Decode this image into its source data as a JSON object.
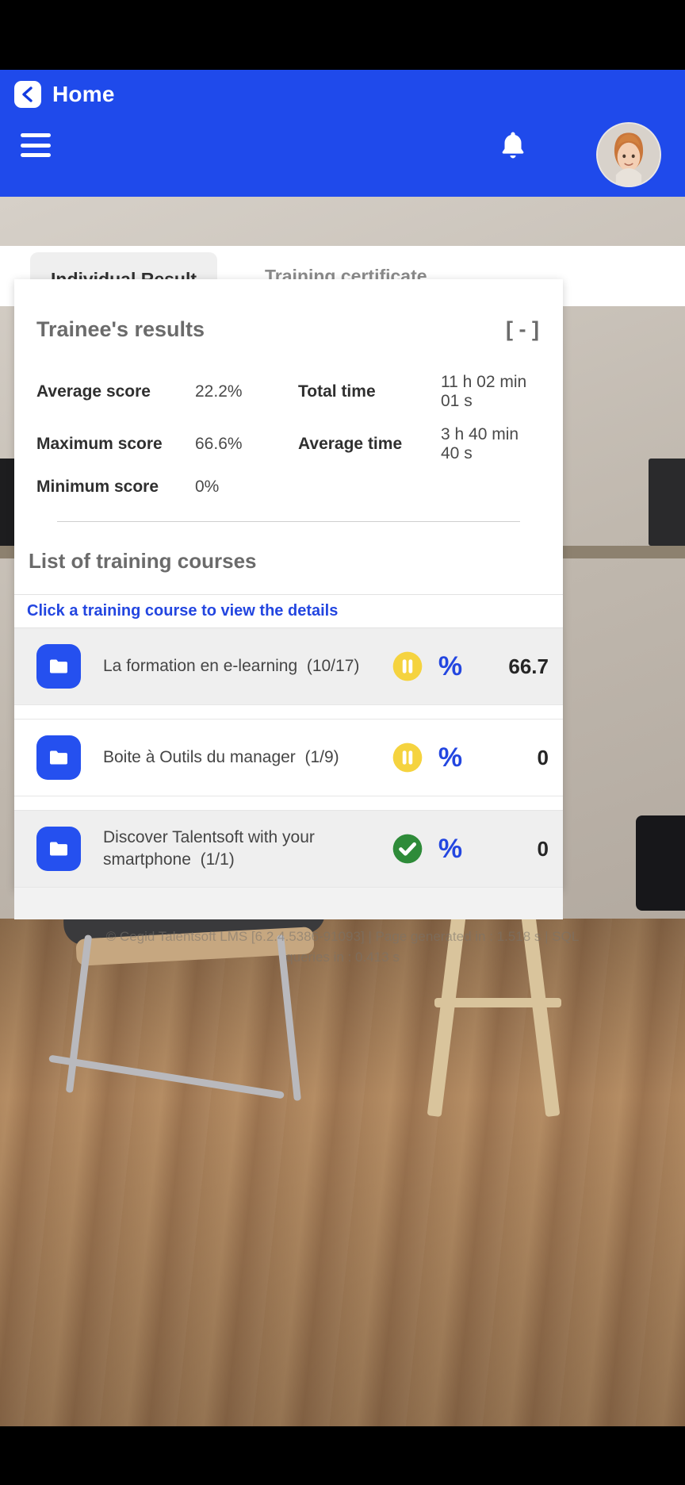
{
  "appbar": {
    "back_icon": "chevron-left-icon",
    "title": "Home",
    "menu_icon": "hamburger-icon",
    "bell_icon": "notification-bell-icon",
    "avatar_icon": "user-avatar",
    "background_color": "#1f4aeb"
  },
  "tabs": [
    {
      "label": "Individual Result",
      "active": true
    },
    {
      "label": "Training certificate",
      "active": false
    }
  ],
  "results_card": {
    "title": "Trainee's results",
    "collapse_label": "[ - ]",
    "stats": [
      {
        "label": "Average score",
        "value": "22.2%",
        "label2": "Total time",
        "value2": "11 h 02 min 01 s"
      },
      {
        "label": "Maximum score",
        "value": "66.6%",
        "label2": "Average time",
        "value2": "3 h 40 min 40 s"
      },
      {
        "label": "Minimum score",
        "value": "0%",
        "label2": "",
        "value2": ""
      }
    ],
    "section_title": "List of training courses",
    "hint": "Click a training course to view the details",
    "hint_color": "#2346e0",
    "courses": [
      {
        "icon": "folder-icon",
        "name": "La formation en e-learning",
        "progress": "(10/17)",
        "status_icon": "pause-circle-icon",
        "status_color": "#f5d33f",
        "percent_icon": "percent-icon",
        "percent_value": "66.7"
      },
      {
        "icon": "folder-icon",
        "name": "Boite à Outils du manager",
        "progress": "(1/9)",
        "status_icon": "pause-circle-icon",
        "status_color": "#f5d33f",
        "percent_icon": "percent-icon",
        "percent_value": "0"
      },
      {
        "icon": "folder-icon",
        "name": "Discover Talentsoft with your smartphone",
        "progress": "(1/1)",
        "status_icon": "check-circle-icon",
        "status_color": "#2e8b39",
        "percent_icon": "percent-icon",
        "percent_value": "0"
      }
    ]
  },
  "footer": {
    "credit_line1": "© Cegid Talentsoft LMS [6.2.4.5386-91093] | Page generated in : 1.518 s | SQL",
    "credit_line2": "queries in : 0.413 s"
  }
}
